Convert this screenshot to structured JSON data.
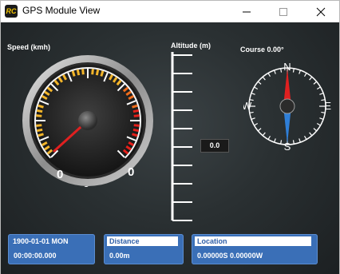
{
  "window": {
    "title": "GPS Module View",
    "icon_text": "RC"
  },
  "speed": {
    "label": "Speed (kmh)",
    "value_left": "0",
    "value_right": "0",
    "value_center": "0",
    "needle_value": 0
  },
  "altitude": {
    "label": "Altitude (m)",
    "readout": "0.0"
  },
  "course": {
    "label": "Course 0.00°",
    "north": "N",
    "south": "S",
    "east": "E",
    "west": "W"
  },
  "panels": {
    "datetime": {
      "date": "1900-01-01 MON",
      "time": "00:00:00.000"
    },
    "distance": {
      "title": "Distance",
      "value": "0.00m"
    },
    "location": {
      "title": "Location",
      "value": "0.00000S 0.00000W"
    }
  },
  "colors": {
    "panel_blue": "#3a6fb7",
    "needle_red": "#e02020",
    "compass_blue": "#2f7fd8"
  },
  "icons": [
    "minimize-icon",
    "maximize-icon",
    "close-icon"
  ]
}
